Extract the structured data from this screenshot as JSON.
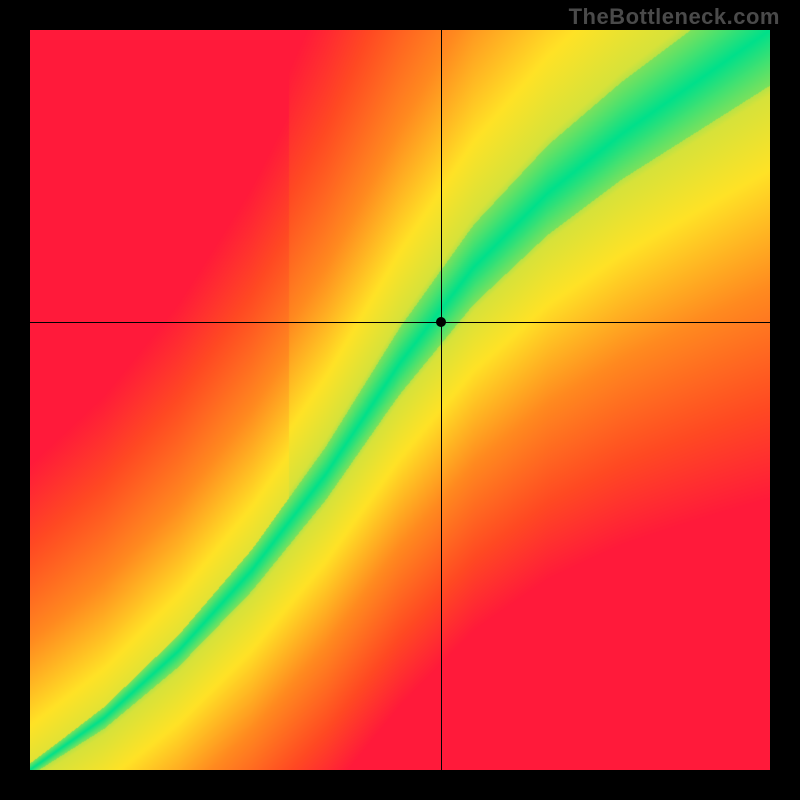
{
  "watermark": "TheBottleneck.com",
  "chart_data": {
    "type": "heatmap",
    "title": "",
    "xlabel": "",
    "ylabel": "",
    "xlim": [
      0,
      1
    ],
    "ylim": [
      0,
      1
    ],
    "crosshair": {
      "x": 0.555,
      "y": 0.605
    },
    "marker": {
      "x": 0.555,
      "y": 0.605
    },
    "ridge": {
      "description": "Green optimal band along a near-diagonal sigmoid-like curve; colors transition green→yellow→orange→red with distance from the ridge.",
      "control_points": [
        {
          "x": 0.0,
          "y": 0.0
        },
        {
          "x": 0.1,
          "y": 0.07
        },
        {
          "x": 0.2,
          "y": 0.16
        },
        {
          "x": 0.3,
          "y": 0.27
        },
        {
          "x": 0.4,
          "y": 0.4
        },
        {
          "x": 0.5,
          "y": 0.55
        },
        {
          "x": 0.6,
          "y": 0.68
        },
        {
          "x": 0.7,
          "y": 0.78
        },
        {
          "x": 0.8,
          "y": 0.86
        },
        {
          "x": 0.9,
          "y": 0.93
        },
        {
          "x": 1.0,
          "y": 1.0
        }
      ],
      "band_halfwidth_start": 0.008,
      "band_halfwidth_end": 0.075
    },
    "color_stops": [
      {
        "t": 0.0,
        "color": "#00e08a"
      },
      {
        "t": 0.14,
        "color": "#d7e23a"
      },
      {
        "t": 0.3,
        "color": "#ffe226"
      },
      {
        "t": 0.55,
        "color": "#ff8a1f"
      },
      {
        "t": 0.8,
        "color": "#ff4a22"
      },
      {
        "t": 1.0,
        "color": "#ff1a3a"
      }
    ]
  }
}
